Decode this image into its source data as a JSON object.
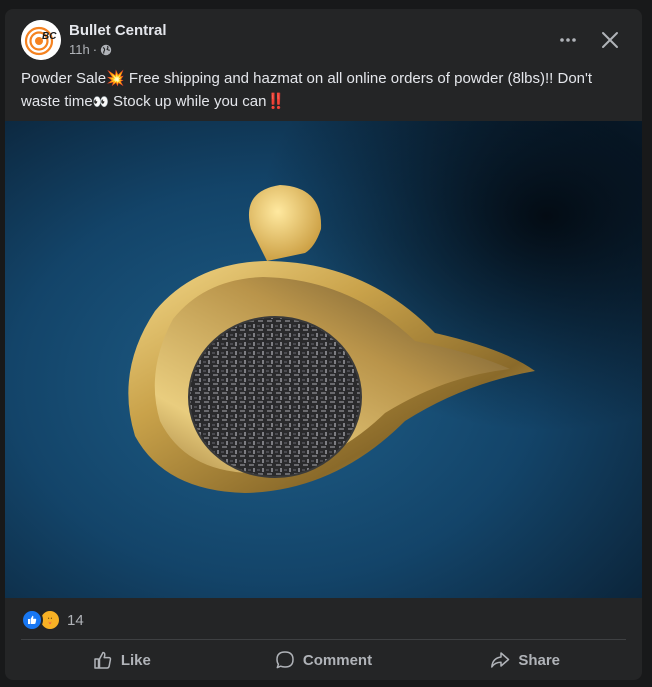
{
  "post": {
    "author": "Bullet Central",
    "avatar_text": "BC",
    "timestamp": "11h",
    "separator": "·",
    "audience_icon": "globe-icon",
    "text_parts": {
      "p1": "Powder Sale",
      "e1": "💥",
      "p2": " Free shipping and hazmat on all online orders of powder (8lbs)!! Don't waste time",
      "e2": "👀",
      "p3": " Stock up while you can",
      "e3": "‼️"
    },
    "image_icon": "powder-scale-pan-photo"
  },
  "reactions": {
    "icons": [
      "like-reaction-icon",
      "care-reaction-icon"
    ],
    "count": "14"
  },
  "actions": {
    "like": "Like",
    "comment": "Comment",
    "share": "Share"
  },
  "colors": {
    "card_bg": "#242526",
    "page_bg": "#18191a",
    "text_primary": "#e4e6eb",
    "text_secondary": "#b0b3b8",
    "like_blue": "#1877f2",
    "avatar_orange": "#f58220"
  }
}
